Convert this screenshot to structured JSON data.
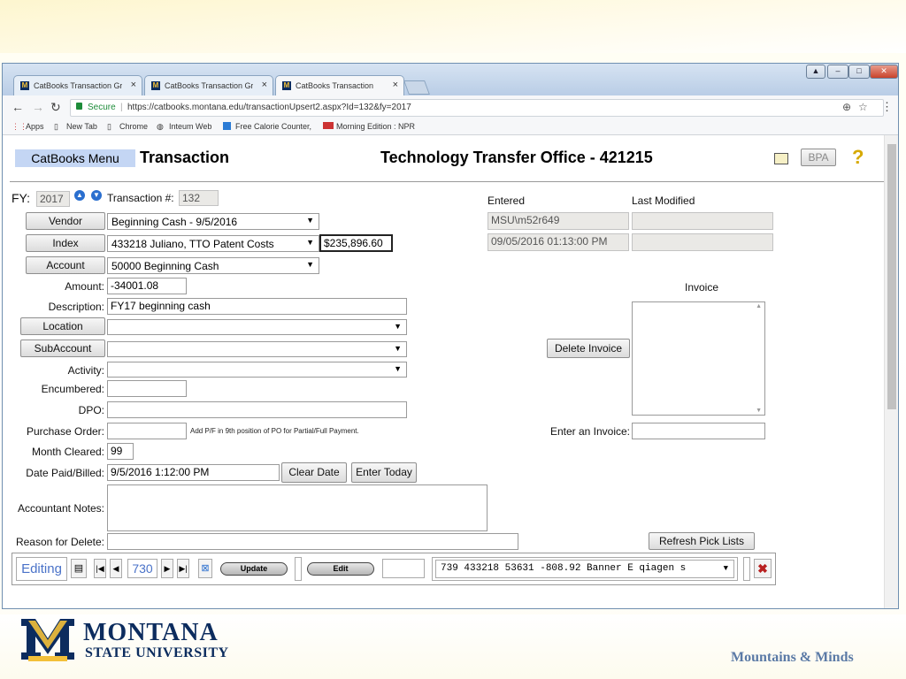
{
  "browser": {
    "tabs": [
      {
        "label": "CatBooks Transaction Gr"
      },
      {
        "label": "CatBooks Transaction Gr"
      },
      {
        "label": "CatBooks Transaction"
      }
    ],
    "security_label": "Secure",
    "url": "https://catbooks.montana.edu/transactionUpsert2.aspx?Id=132&fy=2017",
    "bookmarks": [
      "Apps",
      "New Tab",
      "Chrome",
      "Inteum Web",
      "Free Calorie Counter,",
      "Morning Edition : NPR"
    ]
  },
  "header": {
    "menu_label": "CatBooks Menu",
    "page_title": "Transaction",
    "office_title": "Technology Transfer Office - 421215",
    "bpa_label": "BPA"
  },
  "form": {
    "fy_label": "FY:",
    "fy_value": "2017",
    "transaction_label": "Transaction #:",
    "transaction_value": "132",
    "vendor_button": "Vendor",
    "vendor_value": "Beginning Cash - 9/5/2016",
    "index_button": "Index",
    "index_value": "433218 Juliano, TTO Patent Costs",
    "index_balance": "$235,896.60",
    "account_button": "Account",
    "account_value": "50000 Beginning Cash",
    "amount_label": "Amount:",
    "amount_value": "-34001.08",
    "description_label": "Description:",
    "description_value": "FY17 beginning cash",
    "location_button": "Location",
    "location_value": "",
    "subaccount_button": "SubAccount",
    "subaccount_value": "",
    "activity_label": "Activity:",
    "activity_value": "",
    "encumbered_label": "Encumbered:",
    "encumbered_value": "",
    "dpo_label": "DPO:",
    "dpo_value": "",
    "po_label": "Purchase Order:",
    "po_value": "",
    "po_hint": "Add P/F in 9th position of PO for Partial/Full Payment.",
    "month_cleared_label": "Month Cleared:",
    "month_cleared_value": "99",
    "date_paid_label": "Date Paid/Billed:",
    "date_paid_value": "9/5/2016 1:12:00 PM",
    "clear_date_button": "Clear Date",
    "enter_today_button": "Enter Today",
    "notes_label": "Accountant Notes:",
    "notes_value": "",
    "reason_label": "Reason for Delete:",
    "reason_value": ""
  },
  "audit": {
    "entered_label": "Entered",
    "last_modified_label": "Last Modified",
    "entered_by": "MSU\\m52r649",
    "entered_date": "09/05/2016 01:13:00 PM",
    "modified_by": "",
    "modified_date": ""
  },
  "invoice": {
    "title": "Invoice",
    "delete_button": "Delete Invoice",
    "enter_label": "Enter an Invoice:",
    "enter_value": "",
    "refresh_button": "Refresh Pick Lists"
  },
  "navbar": {
    "mode": "Editing",
    "record_number": "730",
    "update_button": "Update",
    "edit_button": "Edit",
    "search_value": "",
    "record_select": "739 433218 53631 -808.92 Banner E qiagen s"
  },
  "footer": {
    "university_line1": "MONTANA",
    "university_line2": "STATE UNIVERSITY",
    "tagline": "Mountains & Minds"
  },
  "colors": {
    "accent": "#0c2c5e",
    "gold": "#f3c03a",
    "menu_bg": "#c4d6f4"
  }
}
